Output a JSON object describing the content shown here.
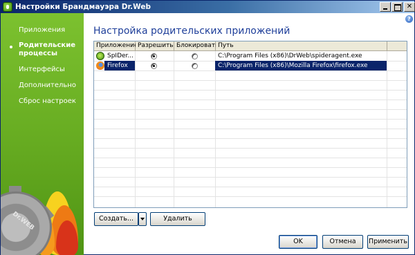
{
  "window": {
    "title": "Настройки Брандмауэра Dr.Web",
    "controls": [
      "minimize",
      "maximize",
      "close"
    ],
    "help_label": "?"
  },
  "sidebar": {
    "items": [
      {
        "label": "Приложения",
        "active": false
      },
      {
        "label_line1": "Родительские",
        "label_line2": "процессы",
        "active": true
      },
      {
        "label": "Интерфейсы",
        "active": false
      },
      {
        "label": "Дополнительно",
        "active": false
      },
      {
        "label": "Сброс настроек",
        "active": false
      }
    ],
    "logo_text": "Dr.WEB"
  },
  "main": {
    "title": "Настройка родительских приложений",
    "table": {
      "columns": [
        "Приложение",
        "Разрешить",
        "Блокировать",
        "Путь"
      ],
      "rows": [
        {
          "app": "SpIDer...",
          "icon": "spider-icon",
          "allow": true,
          "block": false,
          "path": "C:\\Program Files (x86)\\DrWeb\\spideragent.exe",
          "selected": false
        },
        {
          "app": "Firefox",
          "icon": "firefox-icon",
          "allow": true,
          "block": false,
          "path": "C:\\Program Files (x86)\\Mozilla Firefox\\firefox.exe",
          "selected": true
        }
      ]
    },
    "create_label": "Создать...",
    "delete_label": "Удалить"
  },
  "footer": {
    "ok_label": "OK",
    "cancel_label": "Отмена",
    "apply_label": "Применить"
  }
}
